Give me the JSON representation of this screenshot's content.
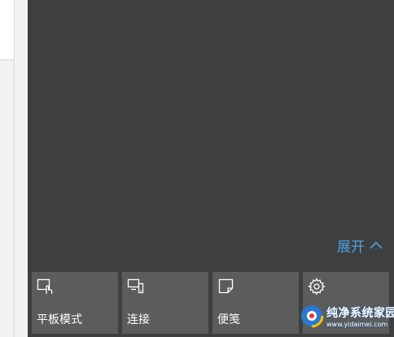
{
  "action_center": {
    "expand_label": "展开",
    "tiles": [
      {
        "label": "平板模式",
        "icon": "tablet-mode-icon"
      },
      {
        "label": "连接",
        "icon": "connect-icon"
      },
      {
        "label": "便笺",
        "icon": "note-icon"
      },
      {
        "label": "",
        "icon": "settings-gear-icon"
      }
    ]
  },
  "watermark": {
    "title": "纯净系统家园",
    "url": "www.yidaimei.com"
  },
  "colors": {
    "panel_bg": "#3f3f3f",
    "tile_bg": "#5c5c5c",
    "accent": "#4aa3e8"
  }
}
